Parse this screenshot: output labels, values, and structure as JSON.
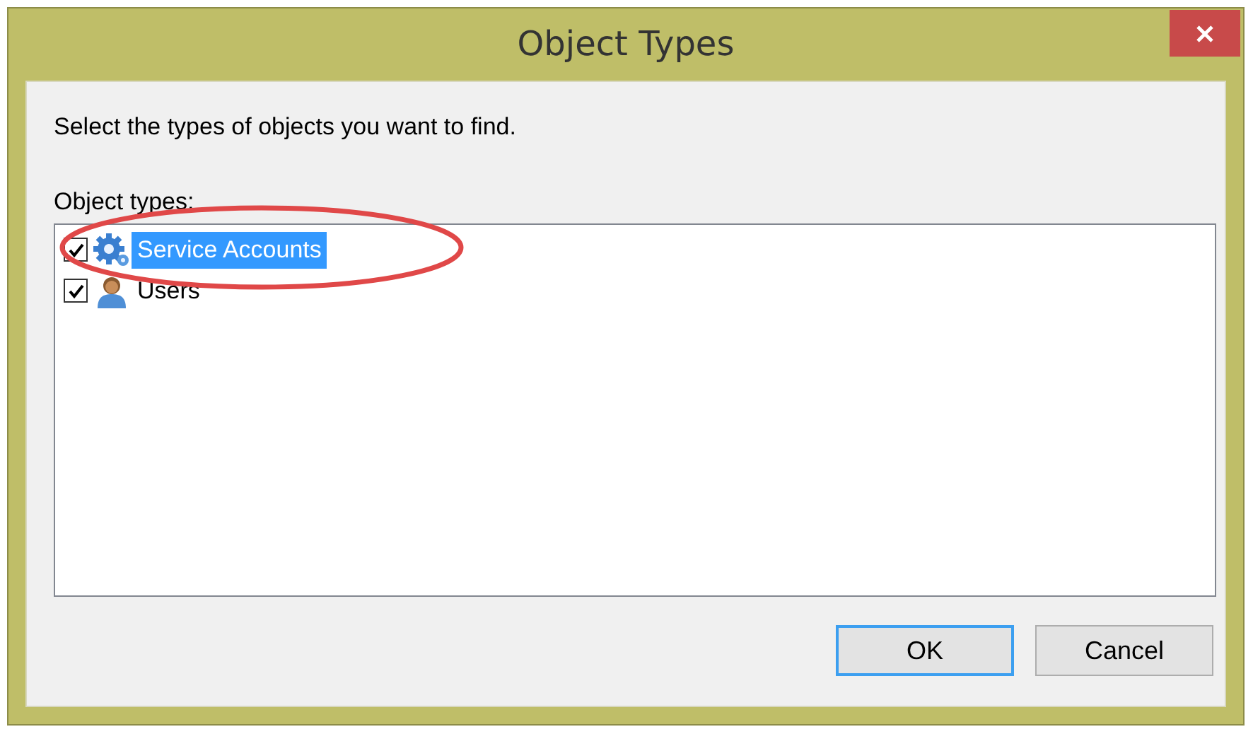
{
  "window": {
    "title": "Object Types"
  },
  "prompt": "Select the types of objects you want to find.",
  "list": {
    "label": "Object types:",
    "items": [
      {
        "kind": "service",
        "label": "Service Accounts",
        "checked": true,
        "selected": true
      },
      {
        "kind": "user",
        "label": "Users",
        "checked": true,
        "selected": false
      }
    ]
  },
  "annotation": {
    "kind": "ellipse"
  },
  "buttons": [
    {
      "label": "OK",
      "default": true
    },
    {
      "label": "Cancel",
      "default": false
    }
  ]
}
